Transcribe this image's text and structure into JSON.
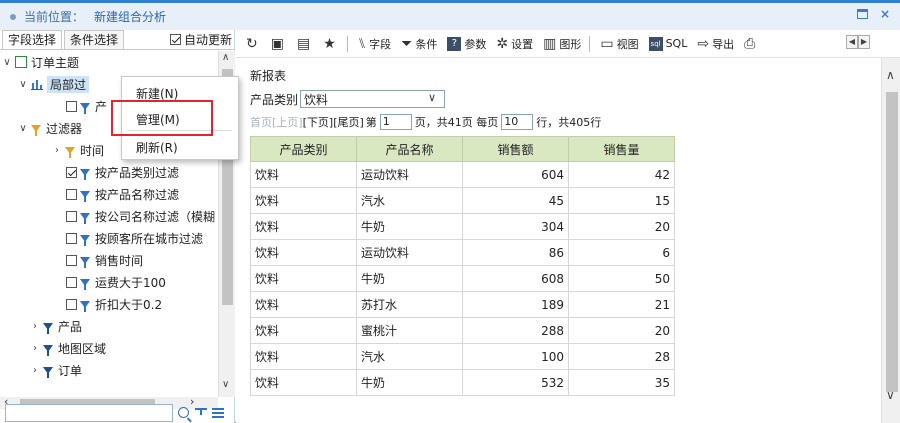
{
  "header": {
    "location_label": "当前位置：",
    "page_name": "新建组合分析"
  },
  "left_panel": {
    "tabs": [
      "字段选择",
      "条件选择"
    ],
    "auto_update_label": "自动更新",
    "tree": {
      "root": "订单主题",
      "local_filter": "局部过",
      "local_child": "产",
      "filters": "过滤器",
      "time_group": "时间",
      "items": [
        {
          "label": "按产品类别过滤",
          "checked": true
        },
        {
          "label": "按产品名称过滤",
          "checked": false
        },
        {
          "label": "按公司名称过滤（模糊",
          "checked": false
        },
        {
          "label": "按顾客所在城市过滤",
          "checked": false
        },
        {
          "label": "销售时间",
          "checked": false
        },
        {
          "label": "运费大于100",
          "checked": false
        },
        {
          "label": "折扣大于0.2",
          "checked": false
        }
      ],
      "groups": [
        "产品",
        "地图区域",
        "订单"
      ]
    },
    "search_placeholder": ""
  },
  "context_menu": {
    "items": [
      "新建(N)",
      "管理(M)",
      "刷新(R)"
    ]
  },
  "toolbar": {
    "items": [
      {
        "icon": "refresh-icon",
        "label": ""
      },
      {
        "icon": "save-icon",
        "label": ""
      },
      {
        "icon": "save-as-icon",
        "label": ""
      },
      {
        "icon": "star-icon",
        "label": ""
      },
      {
        "icon": "field-icon",
        "label": "字段"
      },
      {
        "icon": "condition-icon",
        "label": "条件"
      },
      {
        "icon": "param-icon",
        "label": "参数"
      },
      {
        "icon": "gear-icon",
        "label": "设置"
      },
      {
        "icon": "chart-icon",
        "label": "图形"
      },
      {
        "icon": "view-icon",
        "label": "视图"
      },
      {
        "icon": "sql-icon",
        "label": "SQL"
      },
      {
        "icon": "export-icon",
        "label": "导出"
      },
      {
        "icon": "print-icon",
        "label": ""
      }
    ]
  },
  "report": {
    "title": "新报表",
    "filter_label": "产品类别",
    "filter_value": "饮料",
    "pager": {
      "first": "首页",
      "prev": "[上页]",
      "next": "[下页]",
      "last": "[尾页]",
      "page_prefix": "第",
      "page": "1",
      "page_suffix": "页，共41页 每页",
      "per_page": "10",
      "rows_suffix": "行，共405行"
    },
    "columns": [
      "产品类别",
      "产品名称",
      "销售额",
      "销售量"
    ],
    "rows": [
      [
        "饮料",
        "运动饮料",
        "604",
        "42"
      ],
      [
        "饮料",
        "汽水",
        "45",
        "15"
      ],
      [
        "饮料",
        "牛奶",
        "304",
        "20"
      ],
      [
        "饮料",
        "运动饮料",
        "86",
        "6"
      ],
      [
        "饮料",
        "牛奶",
        "608",
        "50"
      ],
      [
        "饮料",
        "苏打水",
        "189",
        "21"
      ],
      [
        "饮料",
        "蜜桃汁",
        "288",
        "20"
      ],
      [
        "饮料",
        "汽水",
        "100",
        "28"
      ],
      [
        "饮料",
        "牛奶",
        "532",
        "35"
      ]
    ]
  },
  "colors": {
    "accent": "#2f7fd0",
    "header_green": "#dae8c2",
    "highlight_red": "#e0262d"
  }
}
